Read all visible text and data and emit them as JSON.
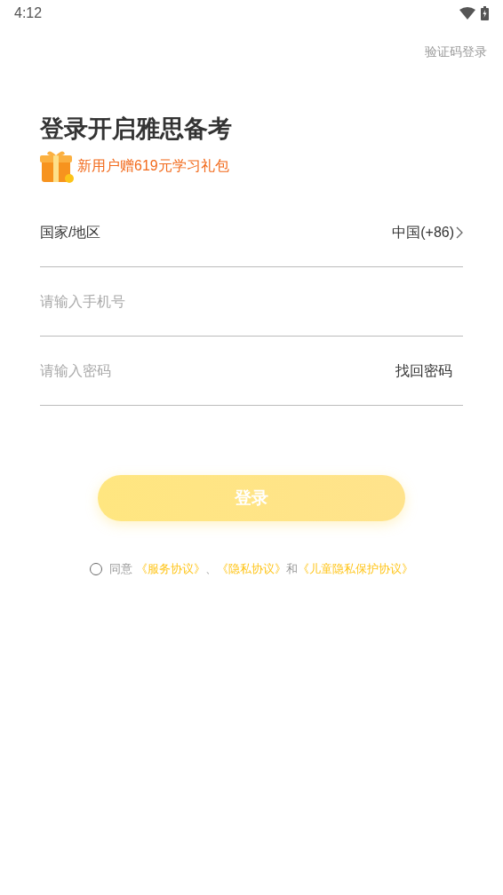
{
  "status_bar": {
    "time": "4:12"
  },
  "top_link": "验证码登录",
  "title": "登录开启雅思备考",
  "promo": "新用户赠619元学习礼包",
  "region": {
    "label": "国家/地区",
    "value": "中国(+86)"
  },
  "phone": {
    "placeholder": "请输入手机号"
  },
  "password": {
    "placeholder": "请输入密码",
    "action": "找回密码"
  },
  "login_button": {
    "label": "登录",
    "disabled": true
  },
  "agreement": {
    "checked": false,
    "prefix": "同意",
    "links": [
      "《服务协议》",
      "《隐私协议》",
      "《儿童隐私保护协议》"
    ],
    "separators": [
      "、",
      "和"
    ]
  }
}
